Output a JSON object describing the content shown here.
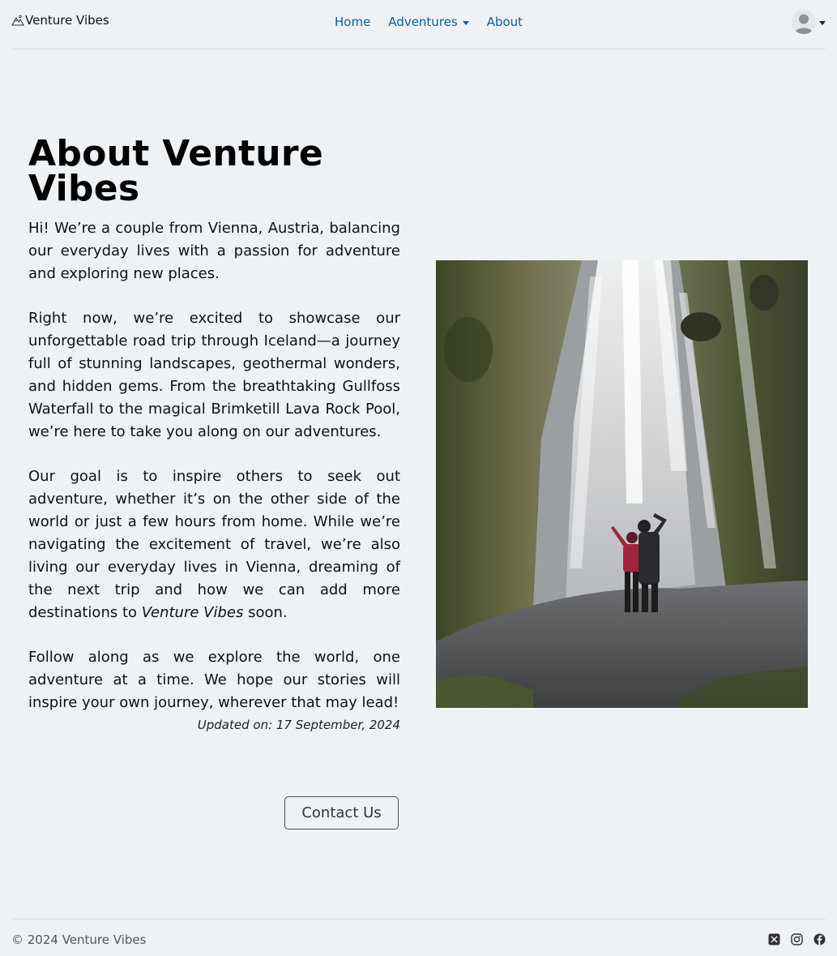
{
  "nav": {
    "brand": "Venture Vibes",
    "links": [
      "Home",
      "Adventures",
      "About"
    ]
  },
  "about": {
    "title": "About Venture Vibes",
    "p1": "Hi! We’re a couple from Vienna, Austria, balancing our everyday lives with a passion for adventure and exploring new places.",
    "p2": "Right now, we’re excited to showcase our unforgettable road trip through Iceland—a journey full of stunning landscapes, geothermal wonders, and hidden gems. From the breathtaking Gullfoss Waterfall to the magical Brimketill Lava Rock Pool, we’re here to take you along on our adventures.",
    "p3_before": "Our goal is to inspire others to seek out adventure, whether it’s on the other side of the world or just a few hours from home. While we’re navigating the excitement of travel, we’re also living our everyday lives in Vienna, dreaming of the next trip and how we can add more destinations to ",
    "p3_em": "Venture Vibes",
    "p3_after": " soon.",
    "p4": "Follow along as we explore the world, one adventure at a time. We hope our stories will inspire your own journey, wherever that may lead!",
    "updated": "Updated on: 17 September, 2024",
    "contact": "Contact Us"
  },
  "footer": {
    "copyright": "© 2024 Venture Vibes",
    "socials": [
      "x-icon",
      "instagram-icon",
      "facebook-icon"
    ]
  },
  "colors": {
    "background": "#eff2f5",
    "link": "#0a5e9c"
  }
}
